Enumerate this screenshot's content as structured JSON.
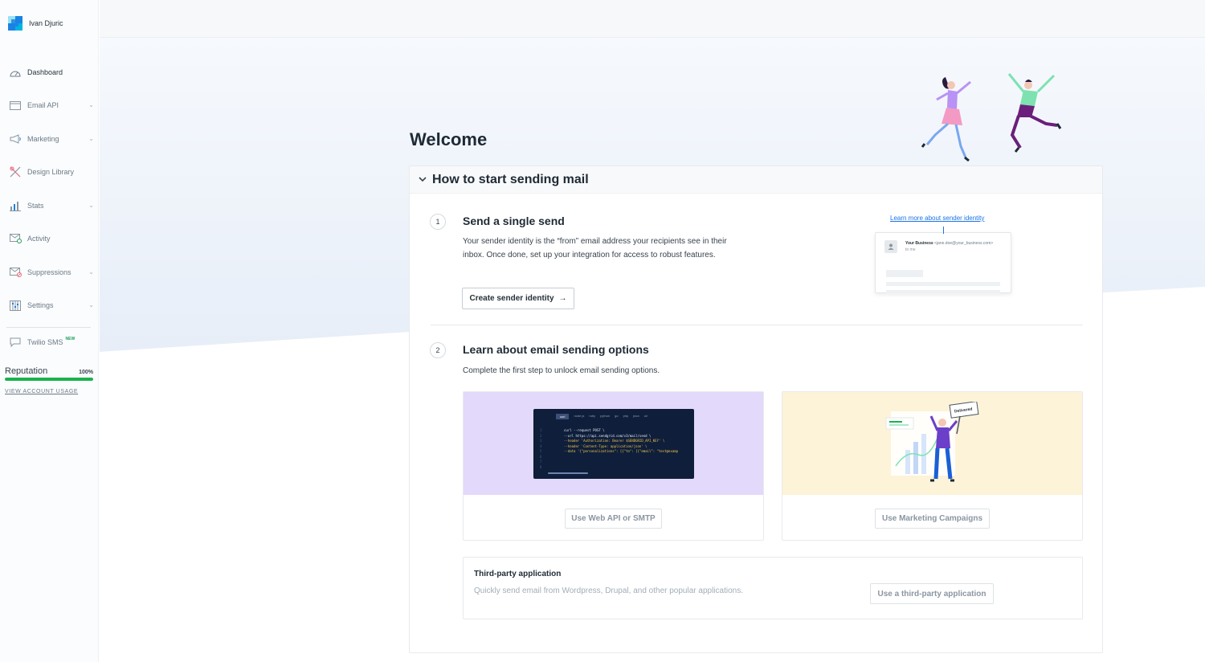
{
  "user": {
    "name": "Ivan Djuric"
  },
  "colors": {
    "brand_blue": "#1a82e2",
    "brand_light": "#99e1f4",
    "accent_link": "#1a73e8",
    "reputation_green": "#1ab24d",
    "code_purple": "#e2d9fb",
    "marketing_yellow": "#fdf3d8"
  },
  "sidebar": {
    "items": [
      {
        "label": "Dashboard",
        "icon": "gauge-icon",
        "active": true,
        "has_chevron": false
      },
      {
        "label": "Email API",
        "icon": "browser-icon",
        "active": false,
        "has_chevron": true
      },
      {
        "label": "Marketing",
        "icon": "megaphone-icon",
        "active": false,
        "has_chevron": true
      },
      {
        "label": "Design Library",
        "icon": "tools-icon",
        "active": false,
        "has_chevron": false
      },
      {
        "label": "Stats",
        "icon": "bar-chart-icon",
        "active": false,
        "has_chevron": true
      },
      {
        "label": "Activity",
        "icon": "mail-activity-icon",
        "active": false,
        "has_chevron": false
      },
      {
        "label": "Suppressions",
        "icon": "mail-block-icon",
        "active": false,
        "has_chevron": true
      },
      {
        "label": "Settings",
        "icon": "sliders-icon",
        "active": false,
        "has_chevron": true
      },
      {
        "label": "Twilio SMS",
        "icon": "chat-icon",
        "active": false,
        "has_chevron": false,
        "badge": "NEW"
      }
    ],
    "reputation": {
      "label": "Reputation",
      "value_text": "100%",
      "value": 1.0,
      "link": "VIEW ACCOUNT USAGE"
    }
  },
  "main": {
    "welcome": "Welcome",
    "section_title": "How to start sending mail",
    "step1": {
      "number": "1",
      "title": "Send a single send",
      "description": "Your sender identity is the “from” email address your recipients see in their inbox. Once done, set up your integration for access to robust features.",
      "button": "Create sender identity",
      "learn_link": "Learn more about sender identity",
      "preview": {
        "business": "Your Business",
        "email": "<jane.doe@your_business.com>",
        "to": "to me"
      }
    },
    "step2": {
      "number": "2",
      "title": "Learn about email sending options",
      "description": "Complete the first step to unlock email sending options.",
      "option_api": "Use Web API or SMTP",
      "option_marketing": "Use Marketing Campaigns",
      "delivered_sign": "Delivered",
      "code_tabs": [
        "curl",
        "node.js",
        "ruby",
        "python",
        "go",
        "php",
        "java",
        "c#"
      ],
      "code_lines": [
        "curl --request POST \\",
        "--url https://api.sendgrid.com/v3/mail/send \\",
        "--header 'Authorization: Bearer $SENDGRID_API_KEY' \\",
        "--header 'Content-Type: application/json' \\",
        "--data '{\"personalizations\": [{\"to\": [{\"email\": \"test@examp"
      ]
    },
    "third_party": {
      "title": "Third-party application",
      "description": "Quickly send email from Wordpress, Drupal, and other popular applications.",
      "button": "Use a third-party application"
    }
  }
}
